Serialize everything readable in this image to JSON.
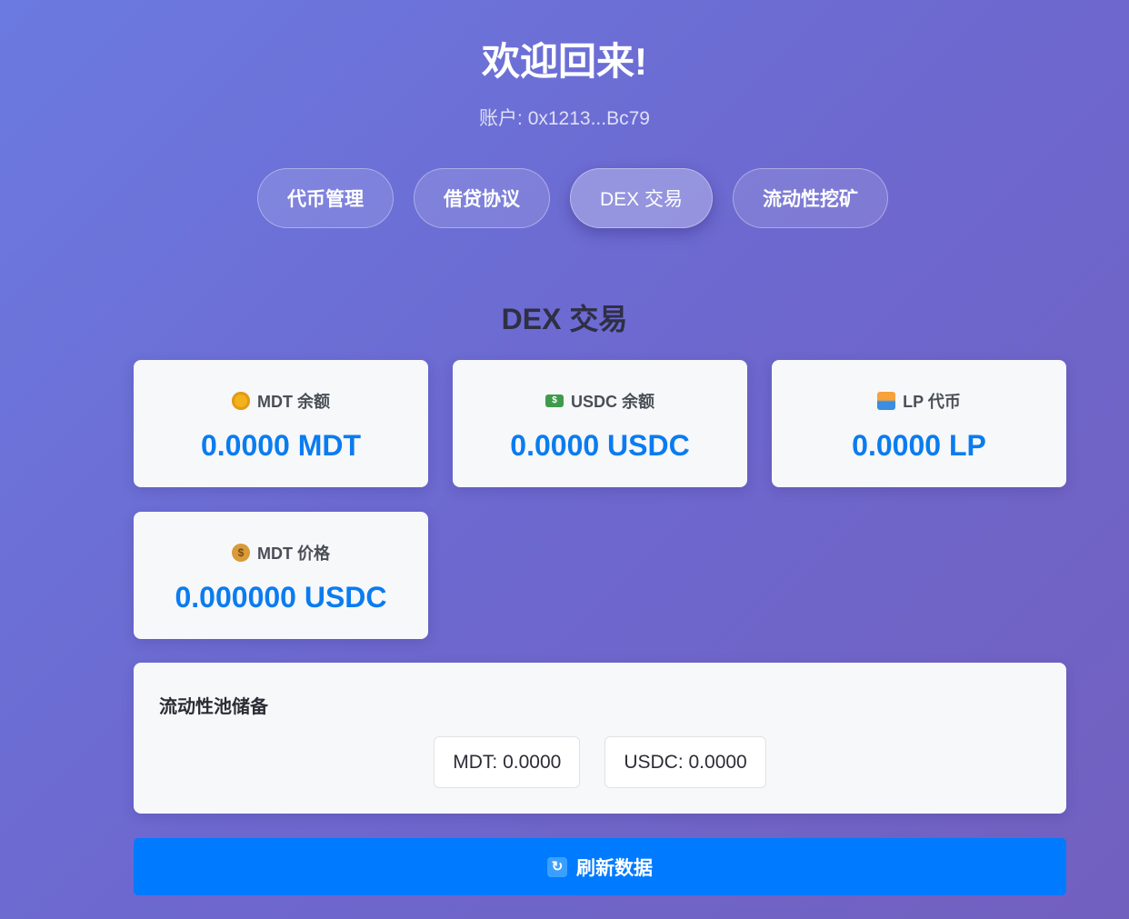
{
  "header": {
    "welcome": "欢迎回来!",
    "account": "账户: 0x1213...Bc79"
  },
  "tabs": [
    {
      "label": "代币管理",
      "active": false
    },
    {
      "label": "借贷协议",
      "active": false
    },
    {
      "label": "DEX 交易",
      "active": true
    },
    {
      "label": "流动性挖矿",
      "active": false
    }
  ],
  "section": {
    "title": "DEX 交易"
  },
  "cards": [
    {
      "icon": "coin-icon",
      "label": "MDT 余额",
      "value": "0.0000 MDT"
    },
    {
      "icon": "dollar-bill-icon",
      "label": "USDC 余额",
      "value": "0.0000 USDC"
    },
    {
      "icon": "lp-token-icon",
      "label": "LP 代币",
      "value": "0.0000 LP"
    },
    {
      "icon": "money-bag-icon",
      "label": "MDT 价格",
      "value": "0.000000 USDC"
    }
  ],
  "reserves": {
    "title": "流动性池储备",
    "items": [
      "MDT: 0.0000",
      "USDC: 0.0000"
    ]
  },
  "refresh": {
    "icon": "refresh-icon",
    "label": "刷新数据"
  },
  "colors": {
    "accent": "#007bff",
    "value_text": "#0a7cf0",
    "background_start": "#6b7ae0",
    "background_end": "#7260bf"
  }
}
